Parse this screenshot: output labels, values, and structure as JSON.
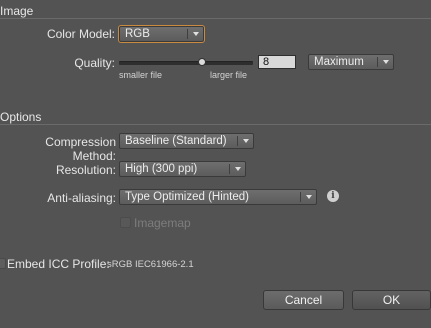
{
  "image": {
    "section_title": "Image",
    "color_model_label": "Color Model:",
    "color_model_value": "RGB",
    "quality_label": "Quality:",
    "quality_value": "8",
    "quality_level": 0.62,
    "quality_preset": "Maximum",
    "smaller_file_label": "smaller file",
    "larger_file_label": "larger file"
  },
  "options": {
    "section_title": "Options",
    "compression_label": "Compression Method:",
    "compression_value": "Baseline (Standard)",
    "resolution_label": "Resolution:",
    "resolution_value": "High (300 ppi)",
    "antialias_label": "Anti-aliasing:",
    "antialias_value": "Type Optimized (Hinted)",
    "imagemap_label": "Imagemap",
    "imagemap_checked": false
  },
  "icc": {
    "label": "Embed ICC Profile:",
    "value": "sRGB IEC61966-2.1",
    "checked": false
  },
  "buttons": {
    "cancel": "Cancel",
    "ok": "OK"
  },
  "colors": {
    "dialog_bg": "#535353",
    "focus_ring": "#c98a42"
  }
}
